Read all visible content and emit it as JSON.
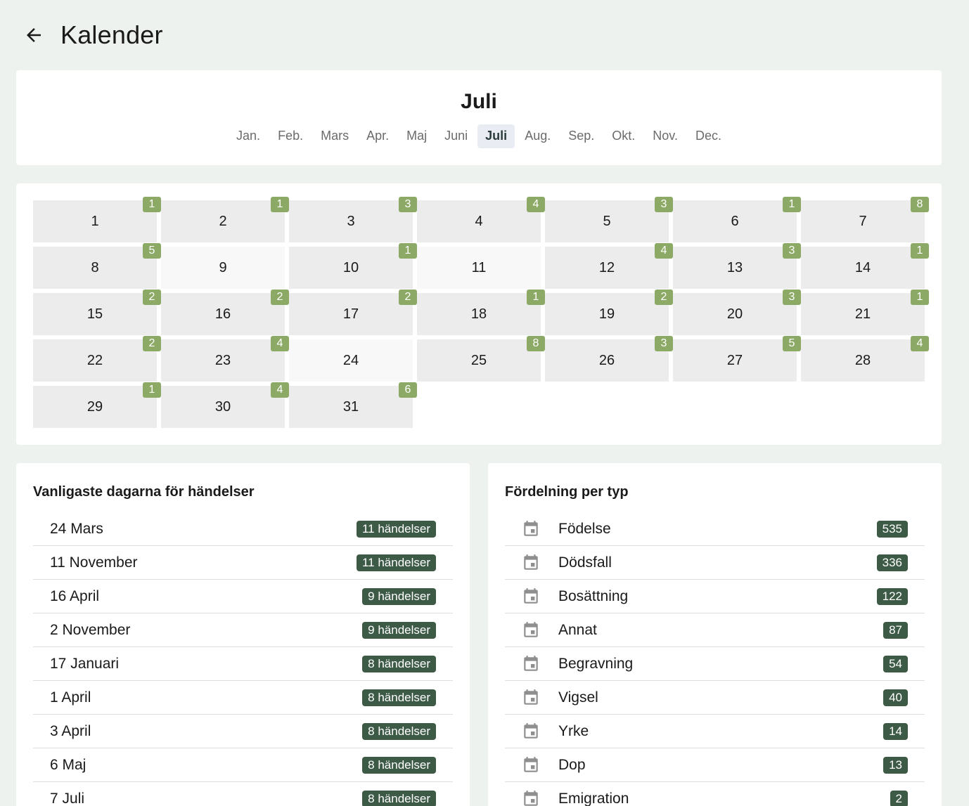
{
  "header": {
    "title": "Kalender"
  },
  "month_selector": {
    "current": "Juli",
    "months": [
      {
        "label": "Jan.",
        "active": false
      },
      {
        "label": "Feb.",
        "active": false
      },
      {
        "label": "Mars",
        "active": false
      },
      {
        "label": "Apr.",
        "active": false
      },
      {
        "label": "Maj",
        "active": false
      },
      {
        "label": "Juni",
        "active": false
      },
      {
        "label": "Juli",
        "active": true
      },
      {
        "label": "Aug.",
        "active": false
      },
      {
        "label": "Sep.",
        "active": false
      },
      {
        "label": "Okt.",
        "active": false
      },
      {
        "label": "Nov.",
        "active": false
      },
      {
        "label": "Dec.",
        "active": false
      }
    ]
  },
  "calendar": {
    "days": [
      {
        "day": "1",
        "count": "1"
      },
      {
        "day": "2",
        "count": "1"
      },
      {
        "day": "3",
        "count": "3"
      },
      {
        "day": "4",
        "count": "4"
      },
      {
        "day": "5",
        "count": "3"
      },
      {
        "day": "6",
        "count": "1"
      },
      {
        "day": "7",
        "count": "8"
      },
      {
        "day": "8",
        "count": "5"
      },
      {
        "day": "9",
        "count": ""
      },
      {
        "day": "10",
        "count": "1"
      },
      {
        "day": "11",
        "count": ""
      },
      {
        "day": "12",
        "count": "4"
      },
      {
        "day": "13",
        "count": "3"
      },
      {
        "day": "14",
        "count": "1"
      },
      {
        "day": "15",
        "count": "2"
      },
      {
        "day": "16",
        "count": "2"
      },
      {
        "day": "17",
        "count": "2"
      },
      {
        "day": "18",
        "count": "1"
      },
      {
        "day": "19",
        "count": "2"
      },
      {
        "day": "20",
        "count": "3"
      },
      {
        "day": "21",
        "count": "1"
      },
      {
        "day": "22",
        "count": "2"
      },
      {
        "day": "23",
        "count": "4"
      },
      {
        "day": "24",
        "count": ""
      },
      {
        "day": "25",
        "count": "8"
      },
      {
        "day": "26",
        "count": "3"
      },
      {
        "day": "27",
        "count": "5"
      },
      {
        "day": "28",
        "count": "4"
      },
      {
        "day": "29",
        "count": "1"
      },
      {
        "day": "30",
        "count": "4"
      },
      {
        "day": "31",
        "count": "6"
      }
    ]
  },
  "common_days": {
    "title": "Vanligaste dagarna för händelser",
    "items": [
      {
        "date": "24 Mars",
        "count": "11 händelser"
      },
      {
        "date": "11 November",
        "count": "11 händelser"
      },
      {
        "date": "16 April",
        "count": "9 händelser"
      },
      {
        "date": "2 November",
        "count": "9 händelser"
      },
      {
        "date": "17 Januari",
        "count": "8 händelser"
      },
      {
        "date": "1 April",
        "count": "8 händelser"
      },
      {
        "date": "3 April",
        "count": "8 händelser"
      },
      {
        "date": "6 Maj",
        "count": "8 händelser"
      },
      {
        "date": "7 Juli",
        "count": "8 händelser"
      }
    ]
  },
  "type_distribution": {
    "title": "Fördelning per typ",
    "icon": "calendar-event-icon",
    "items": [
      {
        "label": "Födelse",
        "count": "535"
      },
      {
        "label": "Dödsfall",
        "count": "336"
      },
      {
        "label": "Bosättning",
        "count": "122"
      },
      {
        "label": "Annat",
        "count": "87"
      },
      {
        "label": "Begravning",
        "count": "54"
      },
      {
        "label": "Vigsel",
        "count": "40"
      },
      {
        "label": "Yrke",
        "count": "14"
      },
      {
        "label": "Dop",
        "count": "13"
      },
      {
        "label": "Emigration",
        "count": "2"
      }
    ]
  },
  "colors": {
    "background": "#eef2ee",
    "day_badge": "#8caa66",
    "count_badge": "#3d5a46",
    "day_cell": "#ececec",
    "day_cell_empty": "#f8f8f8",
    "active_month_bg": "#e9edf3"
  }
}
